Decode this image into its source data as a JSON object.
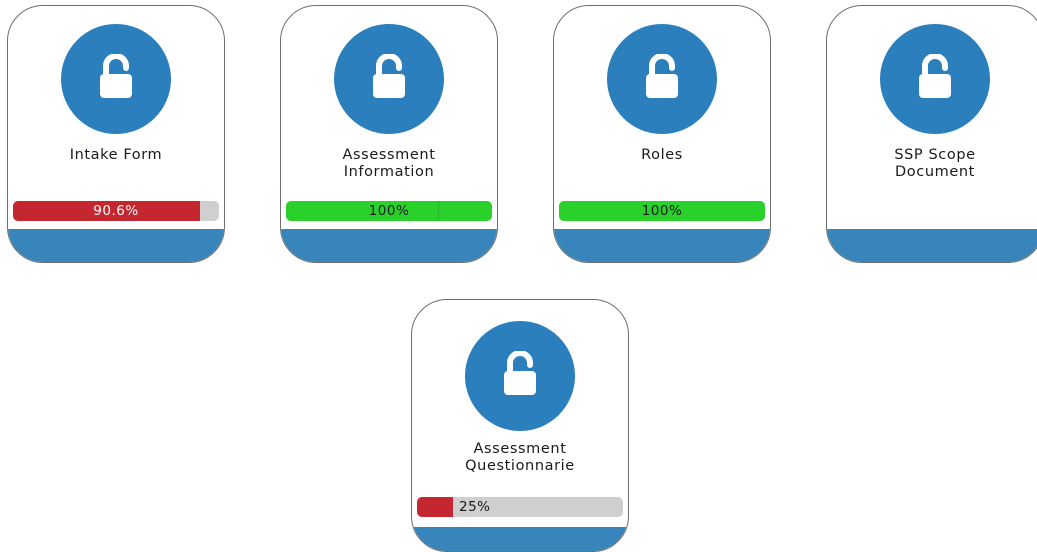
{
  "colors": {
    "accent_blue": "#2b7fbd",
    "footer_blue": "#3885bb",
    "progress_red": "#c4272f",
    "progress_green": "#2bd12b",
    "progress_track": "#cfcfcf"
  },
  "cards": [
    {
      "title_lines": [
        "Intake Form"
      ],
      "icon": "unlocked-padlock-icon",
      "progress": {
        "percent": 90.6,
        "label": "90.6%",
        "color": "red"
      }
    },
    {
      "title_lines": [
        "Assessment",
        "Information"
      ],
      "icon": "unlocked-padlock-icon",
      "progress": {
        "percent": 100,
        "label": "100%",
        "color": "green"
      }
    },
    {
      "title_lines": [
        "Roles"
      ],
      "icon": "unlocked-padlock-icon",
      "progress": {
        "percent": 100,
        "label": "100%",
        "color": "green"
      }
    },
    {
      "title_lines": [
        "SSP Scope",
        "Document"
      ],
      "icon": "unlocked-padlock-icon",
      "progress": null
    },
    {
      "title_lines": [
        "Assessment",
        "Questionnarie"
      ],
      "icon": "unlocked-padlock-icon",
      "progress": {
        "percent": 25,
        "label": "25%",
        "color": "red"
      }
    }
  ]
}
